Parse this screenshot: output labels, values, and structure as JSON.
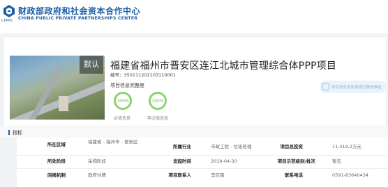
{
  "header": {
    "logo_text": "CPPPC",
    "org_name": "财政部政府和社会资本合作中心",
    "org_name_en": "CHINA PUBLIC PRIVATE PARTNERSHIPS CENTER"
  },
  "colors": {
    "brand": "#1b5ea5",
    "progress": "#8cd46e",
    "follow_bg": "#e8f3fb"
  },
  "project": {
    "image_badge": "默认",
    "title": "福建省福州市晋安区连江北城市管理综合体PPP项目",
    "code_label": "编号：",
    "code": "35011120210311000​1",
    "completeness_label": "项目信息完整度",
    "required_percent": "100%",
    "required_label": "必填信息",
    "optional_percent": "100%",
    "optional_label": "非必填信息",
    "follow_button": "项目信息变化将通过微信推送"
  },
  "indicators": {
    "section_title": "指标",
    "rows": [
      [
        {
          "label": "所在区域",
          "value": "福建省 - 福州市 - 晋安区"
        },
        {
          "label": "所属行业",
          "value": "市政工程 - 垃圾处理"
        },
        {
          "label": "项目总投资",
          "value": "11,419.2万元"
        }
      ],
      [
        {
          "label": "所处阶段",
          "value": "采购阶段"
        },
        {
          "label": "发起时间",
          "value": "2019-04-30"
        },
        {
          "label": "项目示范级别/批次",
          "value": "暂无"
        }
      ],
      [
        {
          "label": "回报机制",
          "value": "政府付费"
        },
        {
          "label": "项目联系人",
          "value": "李应南"
        },
        {
          "label": "联系电话",
          "value": "0591-83640434"
        }
      ]
    ]
  }
}
